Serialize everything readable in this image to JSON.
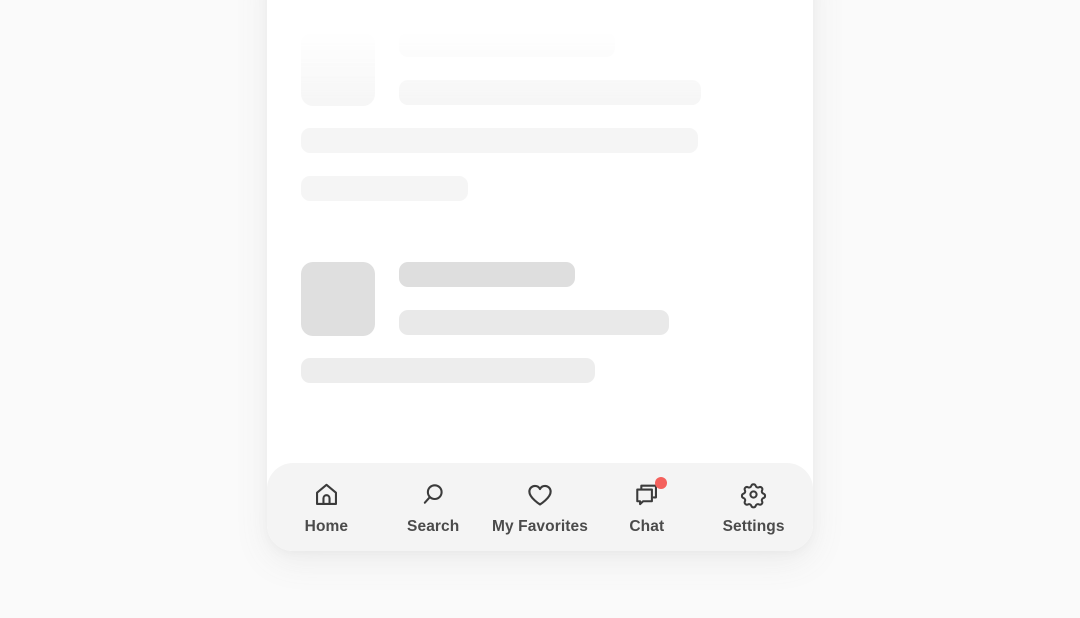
{
  "app": {
    "background_color": "#fafafa",
    "card_color": "#ffffff"
  },
  "content": {
    "state": "loading-skeleton",
    "blocks": [
      {
        "name": "skeleton-block-faded",
        "faded": true,
        "thumbnail": true,
        "bars": [
          {
            "width_pct": 55,
            "tone": "tone-light"
          },
          {
            "width_pct": 77,
            "tone": "tone-light"
          },
          {
            "width_pct": 81,
            "tone": "tone-light"
          },
          {
            "width_pct": 34,
            "tone": "tone-light"
          }
        ]
      },
      {
        "name": "skeleton-block-solid",
        "faded": false,
        "thumbnail": true,
        "bars": [
          {
            "width_pct": 45,
            "tone": "tone-dark"
          },
          {
            "width_pct": 69,
            "tone": "tone-mid"
          },
          {
            "width_pct": 60,
            "tone": "tone-light"
          }
        ]
      }
    ]
  },
  "bottom_nav": {
    "background_color": "#f4f4f4",
    "label_color": "#4b4b4b",
    "badge_color": "#f4605c",
    "items": [
      {
        "id": "home",
        "label": "Home",
        "icon": "home-icon",
        "badge": false
      },
      {
        "id": "search",
        "label": "Search",
        "icon": "search-icon",
        "badge": false
      },
      {
        "id": "favorites",
        "label": "My Favorites",
        "icon": "heart-icon",
        "badge": false
      },
      {
        "id": "chat",
        "label": "Chat",
        "icon": "chat-icon",
        "badge": true
      },
      {
        "id": "settings",
        "label": "Settings",
        "icon": "gear-icon",
        "badge": false
      }
    ]
  }
}
